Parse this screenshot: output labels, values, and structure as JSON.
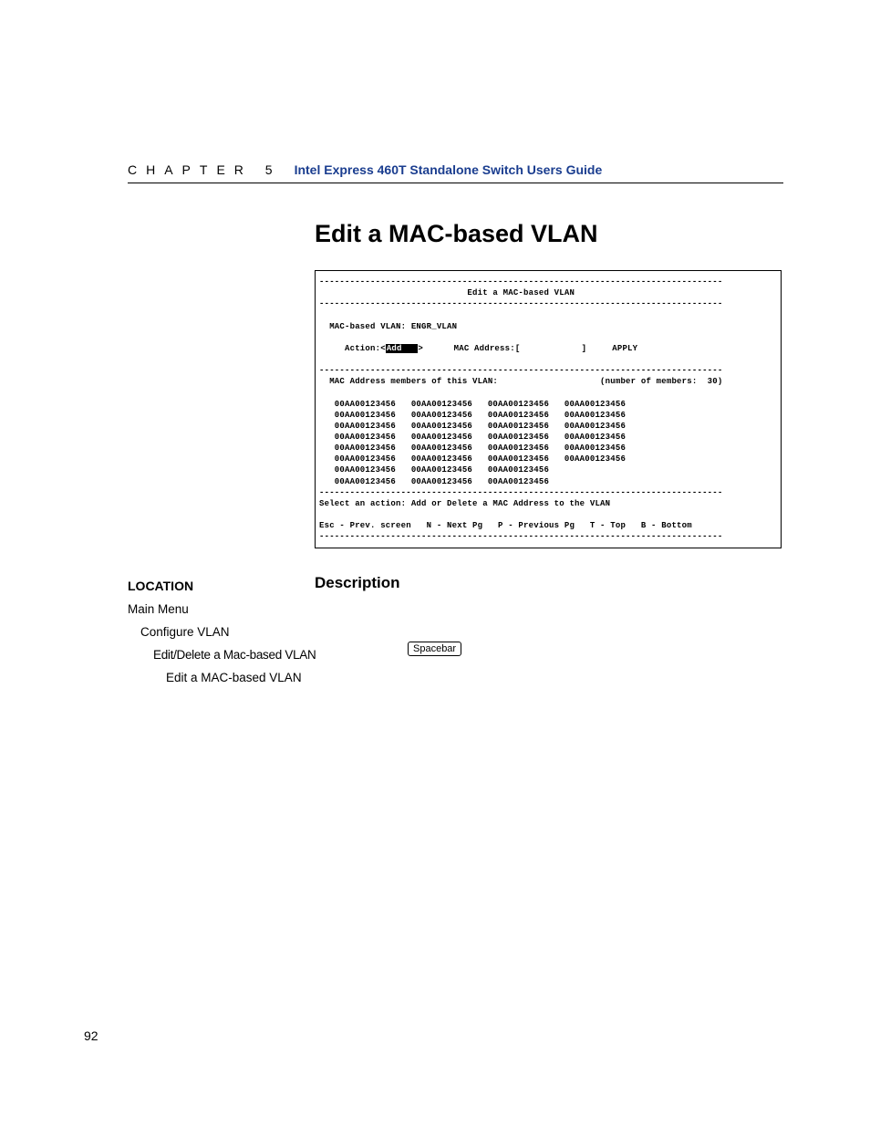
{
  "header": {
    "chapter_label": "CHAPTER 5",
    "guide_title": "Intel Express 460T Standalone Switch Users Guide"
  },
  "page_title": "Edit a MAC-based VLAN",
  "terminal": {
    "dashes": "-------------------------------------------------------------------------------",
    "center_title": "Edit a MAC-based VLAN",
    "vlan_line": "  MAC-based VLAN: ENGR_VLAN",
    "action_label": "     Action:<",
    "action_value": "Add   ",
    "action_suffix": ">      MAC Address:[            ]     APPLY",
    "members_label": "  MAC Address members of this VLAN:",
    "members_count_label": "(number of members:",
    "members_count_value": "30)",
    "mac_rows": [
      [
        "00AA00123456",
        "00AA00123456",
        "00AA00123456",
        "00AA00123456"
      ],
      [
        "00AA00123456",
        "00AA00123456",
        "00AA00123456",
        "00AA00123456"
      ],
      [
        "00AA00123456",
        "00AA00123456",
        "00AA00123456",
        "00AA00123456"
      ],
      [
        "00AA00123456",
        "00AA00123456",
        "00AA00123456",
        "00AA00123456"
      ],
      [
        "00AA00123456",
        "00AA00123456",
        "00AA00123456",
        "00AA00123456"
      ],
      [
        "00AA00123456",
        "00AA00123456",
        "00AA00123456",
        "00AA00123456"
      ],
      [
        "00AA00123456",
        "00AA00123456",
        "00AA00123456",
        ""
      ],
      [
        "00AA00123456",
        "00AA00123456",
        "00AA00123456",
        ""
      ]
    ],
    "hint_line": "Select an action: Add or Delete a MAC Address to the VLAN",
    "nav_line": "Esc - Prev. screen   N - Next Pg   P - Previous Pg   T - Top   B - Bottom"
  },
  "description_heading": "Description",
  "location_heading": "LOCATION",
  "location_path": {
    "l1": "Main Menu",
    "l2": "Configure VLAN",
    "l3": "Edit/Delete a Mac-based VLAN",
    "l4": "Edit a MAC-based VLAN"
  },
  "key_label": "Spacebar",
  "page_number": "92"
}
